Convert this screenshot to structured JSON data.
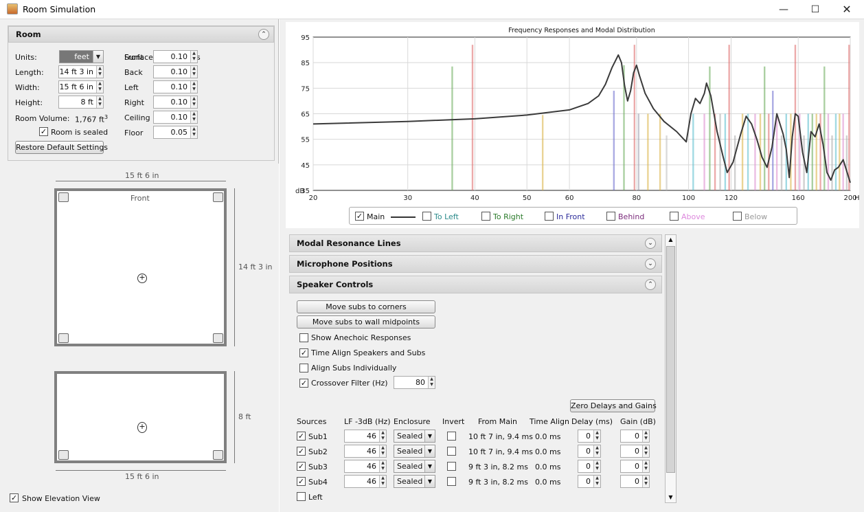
{
  "window": {
    "title": "Room Simulation"
  },
  "room": {
    "section_title": "Room",
    "units_label": "Units:",
    "units_value": "feet",
    "length_label": "Length:",
    "length_value": "14 ft 3 in",
    "width_label": "Width:",
    "width_value": "15 ft 6 in",
    "height_label": "Height:",
    "height_value": "8 ft",
    "volume_label": "Room Volume:",
    "volume_value": "1,767 ft",
    "volume_exp": "3",
    "sealed_label": "Room is sealed",
    "restore_label": "Restore Default Settings",
    "absorptions_title": "Surface Absorptions",
    "surfaces": [
      {
        "label": "Front",
        "value": "0.10"
      },
      {
        "label": "Back",
        "value": "0.10"
      },
      {
        "label": "Left",
        "value": "0.10"
      },
      {
        "label": "Right",
        "value": "0.10"
      },
      {
        "label": "Ceiling",
        "value": "0.10"
      },
      {
        "label": "Floor",
        "value": "0.05"
      }
    ]
  },
  "plan": {
    "top_dim": "15 ft 6 in",
    "side_dim": "14 ft 3 in",
    "front_label": "Front",
    "elev_side_dim": "8 ft",
    "elev_bottom_dim": "15 ft 6 in",
    "show_elevation_label": "Show Elevation View"
  },
  "chart_data": {
    "type": "line",
    "title": "Frequency Responses and Modal Distribution",
    "xlabel": "Hz",
    "ylabel": "dB",
    "xlim": [
      20,
      200
    ],
    "ylim": [
      35,
      95
    ],
    "x_scale": "log",
    "x_ticks": [
      20,
      30,
      40,
      50,
      60,
      80,
      100,
      120,
      160,
      200
    ],
    "y_ticks": [
      35,
      45,
      55,
      65,
      75,
      85,
      95
    ],
    "series": [
      {
        "name": "Main",
        "color": "#3a3a3a",
        "x": [
          20,
          30,
          40,
          50,
          60,
          65,
          68,
          70,
          72,
          74,
          75,
          76,
          77,
          78,
          79,
          80,
          81,
          83,
          86,
          90,
          95,
          99,
          101,
          103,
          105,
          107,
          108,
          110,
          113,
          116,
          118,
          121,
          125,
          128,
          131,
          134,
          137,
          140,
          143,
          146,
          148,
          150,
          152,
          154,
          156,
          158,
          160,
          163,
          166,
          169,
          172,
          175,
          178,
          181,
          184,
          187,
          190,
          194,
          198,
          200
        ],
        "y": [
          61,
          62,
          63,
          64.5,
          66.5,
          69,
          72,
          76.5,
          83,
          88,
          85,
          76,
          70,
          74,
          81,
          84,
          80,
          73,
          67,
          62,
          58,
          54,
          65,
          71,
          69,
          73,
          77,
          72,
          58,
          48,
          42,
          46,
          57,
          64,
          61,
          55,
          48,
          44,
          52,
          65,
          61,
          57,
          51,
          40,
          56,
          65,
          64,
          50,
          42,
          58,
          56,
          61,
          53,
          42,
          39,
          43,
          44,
          47,
          41,
          38
        ]
      }
    ],
    "modal_lines": [
      {
        "hz": 36.3,
        "db": 83.5,
        "color": "#66aa55"
      },
      {
        "hz": 39.6,
        "db": 92,
        "color": "#dd6666"
      },
      {
        "hz": 53.5,
        "db": 64.5,
        "color": "#d8b040"
      },
      {
        "hz": 72.6,
        "db": 74,
        "color": "#6666cc"
      },
      {
        "hz": 75.8,
        "db": 84,
        "color": "#66aa55"
      },
      {
        "hz": 79.3,
        "db": 92,
        "color": "#dd6666"
      },
      {
        "hz": 80.7,
        "db": 65,
        "color": "#9999aa"
      },
      {
        "hz": 84.0,
        "db": 65,
        "color": "#d8b040"
      },
      {
        "hz": 88.5,
        "db": 65,
        "color": "#d8b040"
      },
      {
        "hz": 91.0,
        "db": 56.5,
        "color": "#bbbbbb"
      },
      {
        "hz": 102.0,
        "db": 65,
        "color": "#55bbcc"
      },
      {
        "hz": 107.0,
        "db": 65,
        "color": "#dd88cc"
      },
      {
        "hz": 109.5,
        "db": 83.5,
        "color": "#66aa55"
      },
      {
        "hz": 112.0,
        "db": 65,
        "color": "#dd6666"
      },
      {
        "hz": 114.5,
        "db": 65,
        "color": "#aaaaaa"
      },
      {
        "hz": 117.0,
        "db": 65,
        "color": "#55bbcc"
      },
      {
        "hz": 119.0,
        "db": 92,
        "color": "#dd6666"
      },
      {
        "hz": 122.0,
        "db": 56.5,
        "color": "#aaaaaa"
      },
      {
        "hz": 126.0,
        "db": 65,
        "color": "#d8b040"
      },
      {
        "hz": 129.0,
        "db": 65,
        "color": "#55bbcc"
      },
      {
        "hz": 133.0,
        "db": 65,
        "color": "#dd88cc"
      },
      {
        "hz": 136.0,
        "db": 65,
        "color": "#d8b040"
      },
      {
        "hz": 138.5,
        "db": 83.5,
        "color": "#66aa55"
      },
      {
        "hz": 141.0,
        "db": 65,
        "color": "#dd6666"
      },
      {
        "hz": 143.5,
        "db": 74,
        "color": "#6666cc"
      },
      {
        "hz": 146.0,
        "db": 65,
        "color": "#dd88cc"
      },
      {
        "hz": 149.0,
        "db": 56.5,
        "color": "#aaaaaa"
      },
      {
        "hz": 152.0,
        "db": 65,
        "color": "#55bbcc"
      },
      {
        "hz": 155.0,
        "db": 65,
        "color": "#d8b040"
      },
      {
        "hz": 158.0,
        "db": 92,
        "color": "#dd6666"
      },
      {
        "hz": 161.0,
        "db": 65,
        "color": "#dd88cc"
      },
      {
        "hz": 164.0,
        "db": 56.5,
        "color": "#aaaaaa"
      },
      {
        "hz": 167.0,
        "db": 65,
        "color": "#55bbcc"
      },
      {
        "hz": 170.0,
        "db": 65,
        "color": "#66aa55"
      },
      {
        "hz": 173.0,
        "db": 65,
        "color": "#d8b040"
      },
      {
        "hz": 176.0,
        "db": 65,
        "color": "#dd6666"
      },
      {
        "hz": 179.0,
        "db": 83.5,
        "color": "#66aa55"
      },
      {
        "hz": 182.0,
        "db": 65,
        "color": "#dd88cc"
      },
      {
        "hz": 185.0,
        "db": 56.5,
        "color": "#aaaaaa"
      },
      {
        "hz": 188.0,
        "db": 65,
        "color": "#55bbcc"
      },
      {
        "hz": 191.0,
        "db": 65,
        "color": "#d8b040"
      },
      {
        "hz": 194.0,
        "db": 65,
        "color": "#dd88cc"
      },
      {
        "hz": 197.0,
        "db": 56.5,
        "color": "#aaaaaa"
      },
      {
        "hz": 199.0,
        "db": 92,
        "color": "#dd6666"
      }
    ]
  },
  "legend": [
    {
      "label": "Main",
      "checked": true,
      "color": "#111111"
    },
    {
      "label": "To Left",
      "checked": false,
      "color": "#2a8a8a"
    },
    {
      "label": "To Right",
      "checked": false,
      "color": "#2a7a2a"
    },
    {
      "label": "In Front",
      "checked": false,
      "color": "#2a2a99"
    },
    {
      "label": "Behind",
      "checked": false,
      "color": "#7a2a7a"
    },
    {
      "label": "Above",
      "checked": false,
      "color": "#dd88dd"
    },
    {
      "label": "Below",
      "checked": false,
      "color": "#999999"
    }
  ],
  "sections": {
    "modal": "Modal Resonance Lines",
    "mic": "Microphone Positions",
    "speaker": "Speaker Controls"
  },
  "speaker": {
    "corners_btn": "Move subs to corners",
    "midpoints_btn": "Move subs to wall midpoints",
    "anechoic_label": "Show Anechoic Responses",
    "time_align_label": "Time Align Speakers and Subs",
    "align_subs_label": "Align Subs Individually",
    "crossover_label": "Crossover Filter (Hz)",
    "crossover_value": "80",
    "zero_btn": "Zero Delays and Gains",
    "headers": [
      "Sources",
      "LF -3dB (Hz)",
      "Enclosure",
      "Invert",
      "From Main",
      "Time Align",
      "Delay (ms)",
      "Gain (dB)"
    ],
    "rows": [
      {
        "name": "Sub1",
        "lf": "46",
        "enclosure": "Sealed",
        "from_main": "10 ft 7 in, 9.4 ms",
        "time_align": "0.0 ms",
        "delay": "0",
        "gain": "0"
      },
      {
        "name": "Sub2",
        "lf": "46",
        "enclosure": "Sealed",
        "from_main": "10 ft 7 in, 9.4 ms",
        "time_align": "0.0 ms",
        "delay": "0",
        "gain": "0"
      },
      {
        "name": "Sub3",
        "lf": "46",
        "enclosure": "Sealed",
        "from_main": "9 ft 3 in, 8.2 ms",
        "time_align": "0.0 ms",
        "delay": "0",
        "gain": "0"
      },
      {
        "name": "Sub4",
        "lf": "46",
        "enclosure": "Sealed",
        "from_main": "9 ft 3 in, 8.2 ms",
        "time_align": "0.0 ms",
        "delay": "0",
        "gain": "0"
      }
    ],
    "left_label": "Left"
  }
}
